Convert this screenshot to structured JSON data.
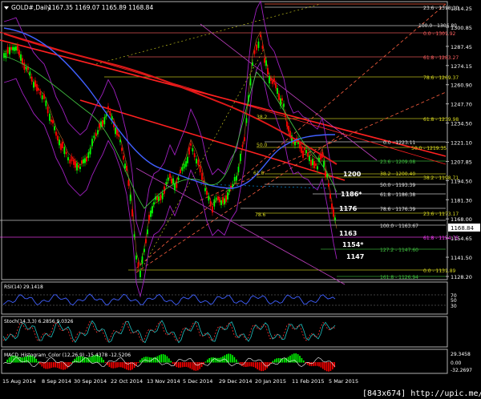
{
  "window": {
    "title": "GOLD#,Daily",
    "ohlc": "1167.35 1169.07 1165.89 1168.84",
    "watermark": "[843x674] http://upic.me/"
  },
  "price_axis": {
    "ticks": [
      "1314.25",
      "1300.85",
      "1287.45",
      "1274.15",
      "1260.90",
      "1247.70",
      "1234.50",
      "1221.10",
      "1207.85",
      "1194.50",
      "1181.30",
      "1168.00",
      "1154.65",
      "1141.50",
      "1128.20"
    ],
    "current": "1168.84"
  },
  "fib_levels": [
    {
      "label": "23.6 - 1318.10",
      "color": "#e0e0e0"
    },
    {
      "label": "100.0 - 1306.80",
      "color": "#e0e0e0"
    },
    {
      "label": "0.0 - 1301.92",
      "color": "#ff6060"
    },
    {
      "label": "61.8 - 1283.27",
      "color": "#ff6060"
    },
    {
      "label": "78.6 - 1269.37",
      "color": "#d8d820"
    },
    {
      "label": "61.8 - 1239.98",
      "color": "#d8d820"
    },
    {
      "label": "0.0 - 1223.11",
      "color": "#e0e0e0"
    },
    {
      "label": "50.0 - 1219.35",
      "color": "#d8d820"
    },
    {
      "label": "23.6 - 1209.08",
      "color": "#40c040"
    },
    {
      "label": "38.2 - 1200.40",
      "color": "#d8d820"
    },
    {
      "label": "38.2 - 1198.71",
      "color": "#d8d820"
    },
    {
      "label": "50.0 - 1193.39",
      "color": "#e0e0e0"
    },
    {
      "label": "61.8 - 1186.38",
      "color": "#e0e0e0"
    },
    {
      "label": "78.6 - 1176.39",
      "color": "#e0e0e0"
    },
    {
      "label": "23.6 - 1173.17",
      "color": "#d8d820"
    },
    {
      "label": "100.0 - 1163.67",
      "color": "#e0e0e0"
    },
    {
      "label": "61.8 - 1154.75",
      "color": "#ff40ff"
    },
    {
      "label": "127.2 - 1147.60",
      "color": "#40c040"
    },
    {
      "label": "0.0 - 1131.89",
      "color": "#d8d820"
    },
    {
      "label": "161.8 - 1126.94",
      "color": "#40c040"
    }
  ],
  "chart_marks": {
    "m1": "38.2",
    "m2": "50.0",
    "m3": "61.8",
    "m4": "78.6"
  },
  "key_levels": [
    "1200",
    "1186*",
    "1176",
    "1163",
    "1154*",
    "1147"
  ],
  "rsi": {
    "title": "RSI(14) 29.1418",
    "ticks": [
      "70",
      "50",
      "30"
    ]
  },
  "stoch": {
    "title": "Stoch(14,3,3) 6.2856 9.0326"
  },
  "macd": {
    "title": "MACD_Histogram_Color (12,26,9) -15.4378 -12.5206",
    "ticks": [
      "29.3458",
      "0.00",
      "-32.2697"
    ]
  },
  "date_axis": [
    "15 Aug 2014",
    "8 Sep 2014",
    "30 Sep 2014",
    "22 Oct 2014",
    "13 Nov 2014",
    "5 Dec 2014",
    "29 Dec 2014",
    "20 Jan 2015",
    "11 Feb 2015",
    "5 Mar 2015"
  ],
  "colors": {
    "up": "#00ff00",
    "down": "#ff0000",
    "ma_red": "#e01818",
    "ma_blue": "#4060ff",
    "band": "#a020c0",
    "fib_text": "#ffff00"
  }
}
